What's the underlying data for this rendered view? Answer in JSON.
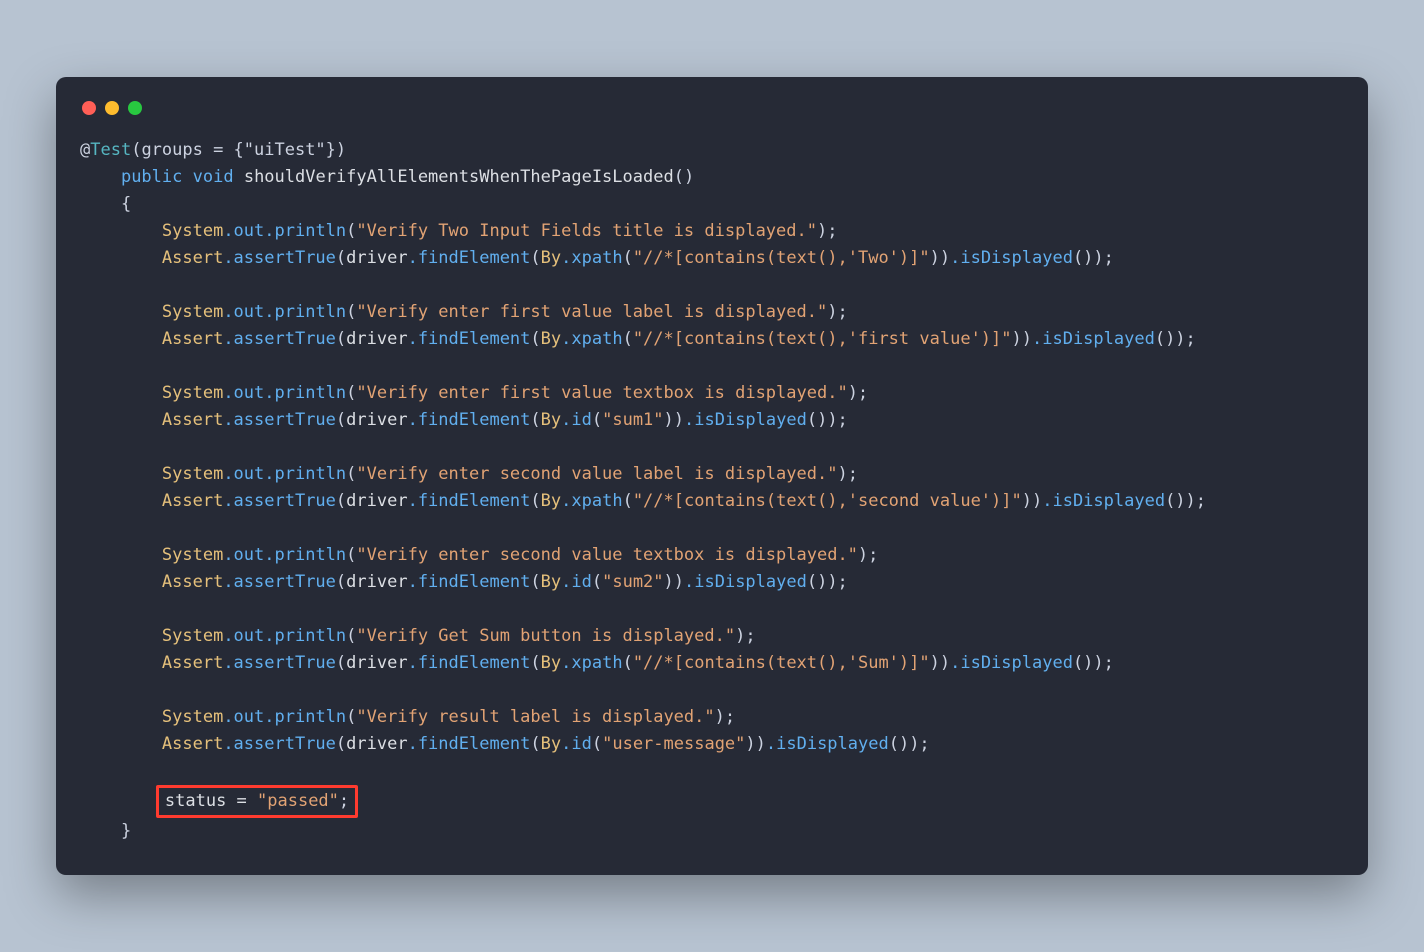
{
  "code": {
    "annotation_at": "@",
    "annotation_name": "Test",
    "annotation_args": "(groups = {\"uiTest\"})",
    "kw_public": "public",
    "kw_void": "void",
    "method_name": "shouldVerifyAllElementsWhenThePageIsLoaded",
    "brace_open": "{",
    "brace_close": "}",
    "sys": "System",
    "out": ".out",
    "println": ".println",
    "asrt": "Assert",
    "assertTrue": ".assertTrue",
    "driver": "driver",
    "findElement": ".findElement",
    "by": "By",
    "xpath": ".xpath",
    "idm": ".id",
    "isDisplayed": ".isDisplayed",
    "println1": "\"Verify Two Input Fields title is displayed.\"",
    "xpath1": "\"//*[contains(text(),'Two')]\"",
    "println2": "\"Verify enter first value label is displayed.\"",
    "xpath2": "\"//*[contains(text(),'first value')]\"",
    "println3": "\"Verify enter first value textbox is displayed.\"",
    "id3": "\"sum1\"",
    "println4": "\"Verify enter second value label is displayed.\"",
    "xpath4": "\"//*[contains(text(),'second value')]\"",
    "println5": "\"Verify enter second value textbox is displayed.\"",
    "id5": "\"sum2\"",
    "println6": "\"Verify Get Sum button is displayed.\"",
    "xpath6": "\"//*[contains(text(),'Sum')]\"",
    "println7": "\"Verify result label is displayed.\"",
    "id7": "\"user-message\"",
    "status_lhs": "status = ",
    "status_val": "\"passed\"",
    "semi": ";"
  }
}
